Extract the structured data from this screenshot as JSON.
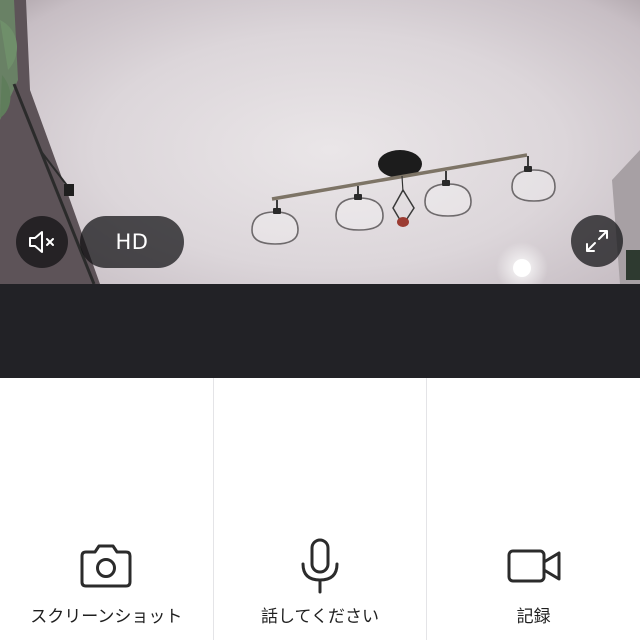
{
  "video": {
    "mute_icon": "speaker-muted-icon",
    "quality_label": "HD",
    "fullscreen_icon": "fullscreen-expand-icon"
  },
  "actions": [
    {
      "label": "スクリーンショット",
      "icon": "camera-icon"
    },
    {
      "label": "話してください",
      "icon": "microphone-icon"
    },
    {
      "label": "記録",
      "icon": "video-camera-icon"
    }
  ]
}
